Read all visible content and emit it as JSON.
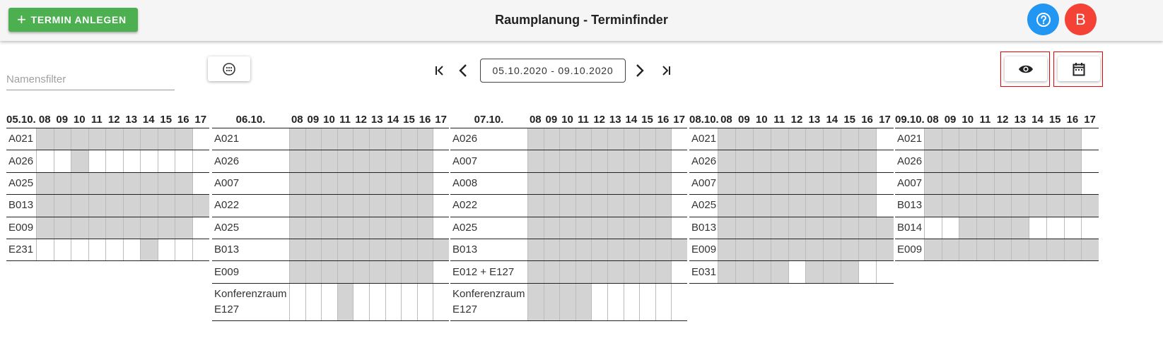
{
  "header": {
    "add_button_label": "TERMIN ANLEGEN",
    "title": "Raumplanung - Terminfinder",
    "avatar_letter": "B"
  },
  "toolbar": {
    "name_filter_placeholder": "Namensfilter",
    "date_range": "05.10.2020 - 09.10.2020"
  },
  "colors": {
    "accent_green": "#4caf50",
    "help_blue": "#2196f3",
    "avatar_red": "#f44336",
    "busy_cell": "#d3d3d3",
    "highlight_frame": "#ee0000"
  },
  "days": [
    {
      "date": "05.10.",
      "hours": [
        "08",
        "09",
        "10",
        "11",
        "12",
        "13",
        "14",
        "15",
        "16",
        "17"
      ],
      "rooms": [
        {
          "name": "A021",
          "slots": [
            1,
            1,
            1,
            1,
            1,
            1,
            1,
            1,
            1,
            0
          ]
        },
        {
          "name": "A026",
          "slots": [
            0,
            0,
            1,
            0,
            0,
            0,
            0,
            0,
            0,
            0
          ]
        },
        {
          "name": "A025",
          "slots": [
            1,
            1,
            1,
            1,
            1,
            1,
            1,
            1,
            1,
            0
          ]
        },
        {
          "name": "B013",
          "slots": [
            1,
            1,
            1,
            1,
            1,
            1,
            1,
            1,
            1,
            1
          ]
        },
        {
          "name": "E009",
          "slots": [
            1,
            1,
            1,
            1,
            1,
            1,
            1,
            1,
            1,
            0
          ]
        },
        {
          "name": "E231",
          "slots": [
            0,
            0,
            0,
            0,
            0,
            0,
            1,
            0,
            0,
            0
          ]
        }
      ]
    },
    {
      "date": "06.10.",
      "hours": [
        "08",
        "09",
        "10",
        "11",
        "12",
        "13",
        "14",
        "15",
        "16",
        "17"
      ],
      "rooms": [
        {
          "name": "A021",
          "slots": [
            1,
            1,
            1,
            1,
            1,
            1,
            1,
            1,
            1,
            0
          ]
        },
        {
          "name": "A026",
          "slots": [
            1,
            1,
            1,
            1,
            1,
            1,
            1,
            1,
            1,
            0
          ]
        },
        {
          "name": "A007",
          "slots": [
            1,
            1,
            1,
            1,
            1,
            1,
            1,
            1,
            1,
            0
          ]
        },
        {
          "name": "A022",
          "slots": [
            1,
            1,
            1,
            1,
            1,
            1,
            1,
            1,
            1,
            0
          ]
        },
        {
          "name": "A025",
          "slots": [
            1,
            1,
            1,
            1,
            1,
            1,
            1,
            1,
            1,
            0
          ]
        },
        {
          "name": "B013",
          "slots": [
            1,
            1,
            1,
            1,
            1,
            1,
            1,
            1,
            1,
            1
          ]
        },
        {
          "name": "E009",
          "slots": [
            1,
            1,
            1,
            1,
            1,
            1,
            1,
            1,
            1,
            0
          ]
        },
        {
          "name": "Konferenzraum E127",
          "slots": [
            0,
            0,
            0,
            1,
            0,
            0,
            0,
            0,
            0,
            0
          ]
        }
      ]
    },
    {
      "date": "07.10.",
      "hours": [
        "08",
        "09",
        "10",
        "11",
        "12",
        "13",
        "14",
        "15",
        "16",
        "17"
      ],
      "rooms": [
        {
          "name": "A026",
          "slots": [
            1,
            1,
            1,
            1,
            1,
            1,
            1,
            1,
            1,
            0
          ]
        },
        {
          "name": "A007",
          "slots": [
            1,
            1,
            1,
            1,
            1,
            1,
            1,
            1,
            1,
            0
          ]
        },
        {
          "name": "A008",
          "slots": [
            1,
            1,
            1,
            1,
            1,
            1,
            1,
            1,
            1,
            0
          ]
        },
        {
          "name": "A022",
          "slots": [
            1,
            1,
            1,
            1,
            1,
            1,
            1,
            1,
            1,
            0
          ]
        },
        {
          "name": "A025",
          "slots": [
            1,
            1,
            1,
            1,
            1,
            1,
            1,
            1,
            1,
            0
          ]
        },
        {
          "name": "B013",
          "slots": [
            1,
            1,
            1,
            1,
            1,
            1,
            1,
            1,
            1,
            1
          ]
        },
        {
          "name": "E012 + E127",
          "slots": [
            1,
            1,
            1,
            1,
            1,
            1,
            1,
            1,
            1,
            0
          ]
        },
        {
          "name": "Konferenzraum E127",
          "slots": [
            1,
            1,
            1,
            1,
            0,
            0,
            0,
            0,
            0,
            0
          ]
        }
      ]
    },
    {
      "date": "08.10.",
      "hours": [
        "08",
        "09",
        "10",
        "11",
        "12",
        "13",
        "14",
        "15",
        "16",
        "17"
      ],
      "rooms": [
        {
          "name": "A021",
          "slots": [
            1,
            1,
            1,
            1,
            1,
            1,
            1,
            1,
            1,
            0
          ]
        },
        {
          "name": "A026",
          "slots": [
            1,
            1,
            1,
            1,
            1,
            1,
            1,
            1,
            1,
            0
          ]
        },
        {
          "name": "A007",
          "slots": [
            1,
            1,
            1,
            1,
            1,
            1,
            1,
            1,
            1,
            0
          ]
        },
        {
          "name": "A025",
          "slots": [
            1,
            1,
            1,
            1,
            1,
            1,
            1,
            1,
            1,
            0
          ]
        },
        {
          "name": "B013",
          "slots": [
            1,
            1,
            1,
            1,
            1,
            1,
            1,
            1,
            1,
            1
          ]
        },
        {
          "name": "E009",
          "slots": [
            1,
            1,
            1,
            1,
            1,
            1,
            1,
            1,
            1,
            1
          ]
        },
        {
          "name": "E031",
          "slots": [
            1,
            1,
            1,
            1,
            0,
            1,
            1,
            1,
            0,
            0
          ]
        }
      ]
    },
    {
      "date": "09.10.",
      "hours": [
        "08",
        "09",
        "10",
        "11",
        "12",
        "13",
        "14",
        "15",
        "16",
        "17"
      ],
      "rooms": [
        {
          "name": "A021",
          "slots": [
            1,
            1,
            1,
            1,
            1,
            1,
            1,
            1,
            1,
            0
          ]
        },
        {
          "name": "A026",
          "slots": [
            1,
            1,
            1,
            1,
            1,
            1,
            1,
            1,
            1,
            0
          ]
        },
        {
          "name": "A007",
          "slots": [
            1,
            1,
            1,
            1,
            1,
            1,
            1,
            1,
            1,
            0
          ]
        },
        {
          "name": "B013",
          "slots": [
            1,
            1,
            1,
            1,
            1,
            1,
            1,
            1,
            1,
            1
          ]
        },
        {
          "name": "B014",
          "slots": [
            0,
            0,
            1,
            1,
            1,
            1,
            0,
            0,
            0,
            0
          ]
        },
        {
          "name": "E009",
          "slots": [
            1,
            1,
            1,
            1,
            1,
            1,
            1,
            1,
            1,
            1
          ]
        }
      ]
    }
  ]
}
